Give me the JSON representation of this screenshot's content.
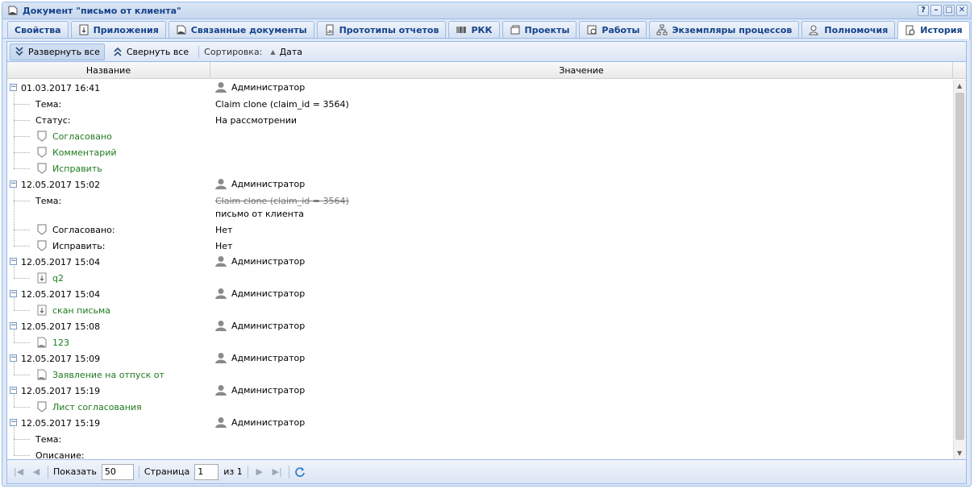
{
  "window": {
    "title": "Документ \"письмо от клиента\"",
    "tools": [
      "?",
      "–",
      "□",
      "✕"
    ]
  },
  "tabs": [
    {
      "label": "Свойства",
      "icon": ""
    },
    {
      "label": "Приложения",
      "icon": "attachment-icon"
    },
    {
      "label": "Связанные документы",
      "icon": "document-icon"
    },
    {
      "label": "Прототипы отчетов",
      "icon": "report-icon"
    },
    {
      "label": "РКК",
      "icon": "barcode-icon"
    },
    {
      "label": "Проекты",
      "icon": "projects-icon"
    },
    {
      "label": "Работы",
      "icon": "calendar-icon"
    },
    {
      "label": "Экземпляры процессов",
      "icon": "process-icon"
    },
    {
      "label": "Полномочия",
      "icon": "permissions-icon"
    },
    {
      "label": "История",
      "icon": "history-icon",
      "active": true
    }
  ],
  "toolbar": {
    "expand_all": "Развернуть все",
    "collapse_all": "Свернуть все",
    "sort_label": "Сортировка:",
    "sort_field": "Дата"
  },
  "columns": {
    "name": "Название",
    "value": "Значение"
  },
  "rows": [
    {
      "kind": "group",
      "text": "01.03.2017 16:41",
      "user": "Администратор"
    },
    {
      "kind": "field",
      "text": "Тема:",
      "value": "Claim clone (claim_id = 3564)"
    },
    {
      "kind": "field",
      "text": "Статус:",
      "value": "На рассмотрении"
    },
    {
      "kind": "link",
      "icon": "shield",
      "text": "Согласовано"
    },
    {
      "kind": "link",
      "icon": "shield",
      "text": "Комментарий"
    },
    {
      "kind": "link",
      "icon": "shield",
      "text": "Исправить"
    },
    {
      "kind": "group",
      "text": "12.05.2017 15:02",
      "user": "Администратор"
    },
    {
      "kind": "field2",
      "text": "Тема:",
      "old": "Claim clone (claim_id = 3564)",
      "value": "письмо от клиента"
    },
    {
      "kind": "field-icon",
      "icon": "shield",
      "text": "Согласовано:",
      "value": "Нет"
    },
    {
      "kind": "field-icon",
      "icon": "shield",
      "text": "Исправить:",
      "value": "Нет"
    },
    {
      "kind": "group",
      "text": "12.05.2017 15:04",
      "user": "Администратор"
    },
    {
      "kind": "link",
      "icon": "attach",
      "text": "q2"
    },
    {
      "kind": "group",
      "text": "12.05.2017 15:04",
      "user": "Администратор"
    },
    {
      "kind": "link",
      "icon": "attach",
      "text": "скан письма"
    },
    {
      "kind": "group",
      "text": "12.05.2017 15:08",
      "user": "Администратор"
    },
    {
      "kind": "link",
      "icon": "doc",
      "text": "123"
    },
    {
      "kind": "group",
      "text": "12.05.2017 15:09",
      "user": "Администратор"
    },
    {
      "kind": "link",
      "icon": "doc",
      "text": "Заявление на отпуск от"
    },
    {
      "kind": "group",
      "text": "12.05.2017 15:19",
      "user": "Администратор"
    },
    {
      "kind": "link",
      "icon": "shield",
      "text": "Лист согласования"
    },
    {
      "kind": "group",
      "text": "12.05.2017 15:19",
      "user": "Администратор"
    },
    {
      "kind": "field",
      "text": "Тема:",
      "value": ""
    },
    {
      "kind": "field",
      "text": "Описание:",
      "value": ""
    }
  ],
  "pager": {
    "show_label": "Показать",
    "page_size": "50",
    "page_label": "Страница",
    "page": "1",
    "of_label": "из 1"
  }
}
